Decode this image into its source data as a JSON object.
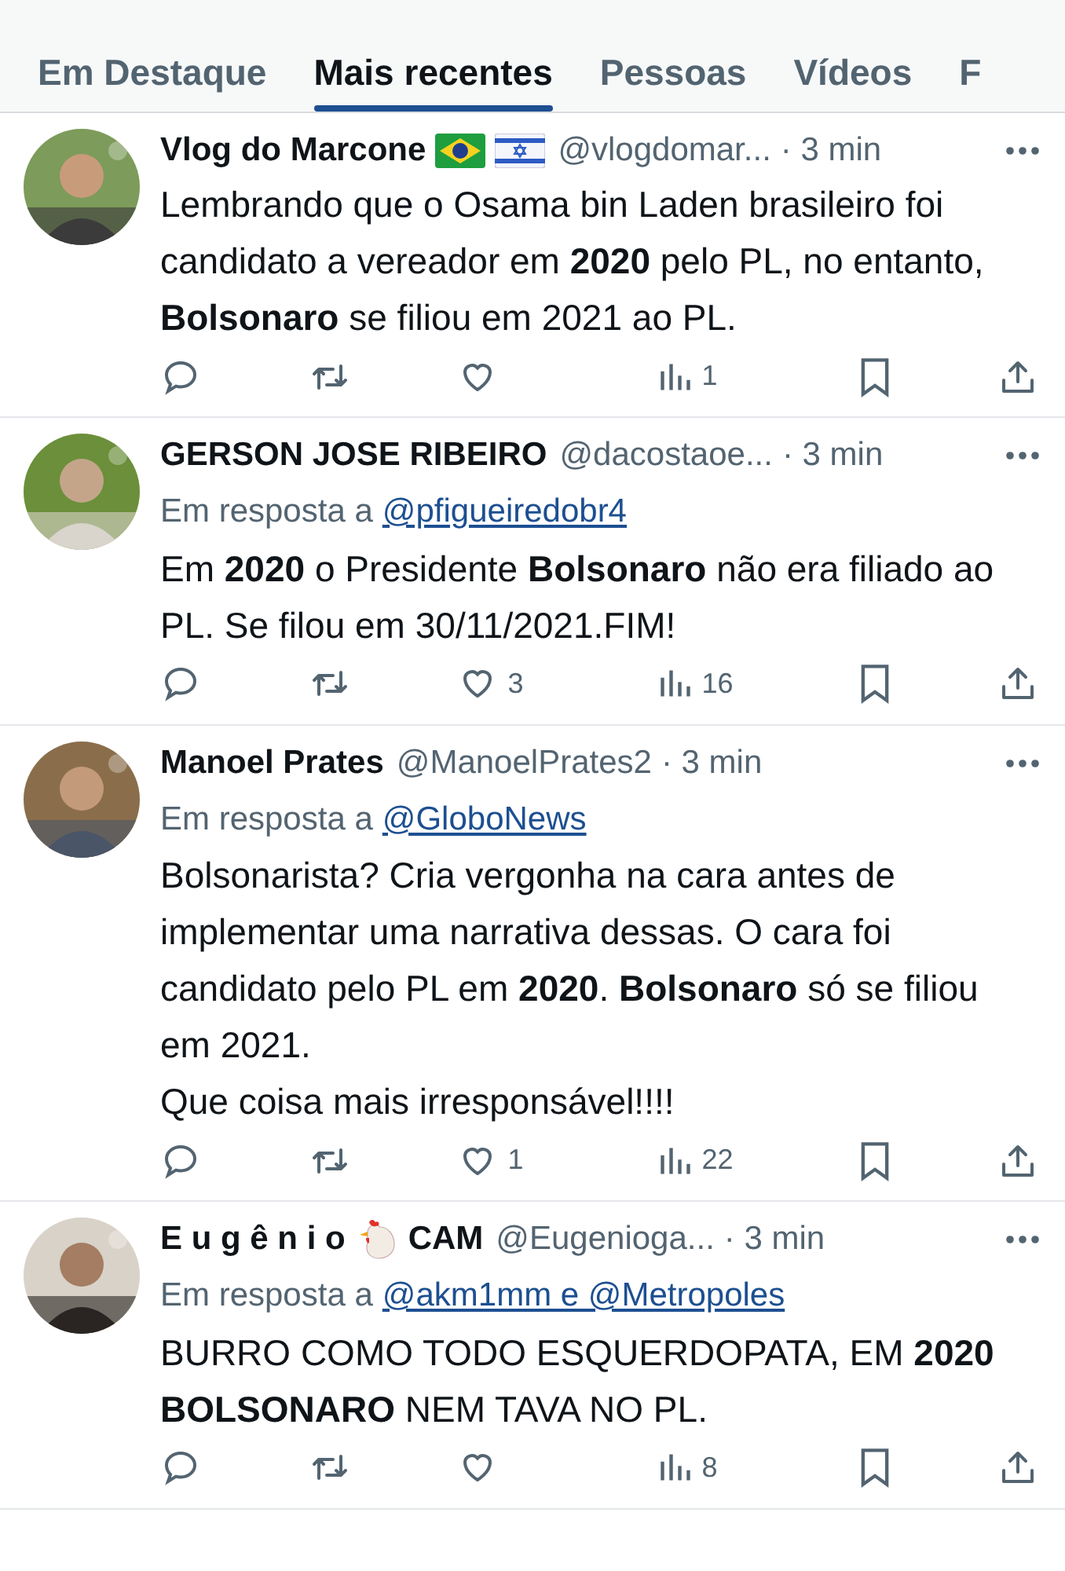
{
  "tabs": [
    {
      "label": "Em Destaque",
      "selected": false
    },
    {
      "label": "Mais recentes",
      "selected": true
    },
    {
      "label": "Pessoas",
      "selected": false
    },
    {
      "label": "Vídeos",
      "selected": false
    },
    {
      "label": "F",
      "selected": false
    }
  ],
  "tweets": [
    {
      "name": "Vlog do Marcone",
      "badges": [
        {
          "kind": "flag-brazil"
        },
        {
          "kind": "flag-israel"
        }
      ],
      "handle": "@vlogdomar...",
      "time": "· 3 min",
      "text": "Lembrando que o Osama bin Laden brasileiro foi candidato a vereador em **2020** pelo PL, no entanto, **Bolsonaro** se filiou em 2021 ao PL.",
      "views": "1"
    },
    {
      "name": "GERSON JOSE RIBEIRO",
      "handle": "@dacostaoe...",
      "time": "· 3 min",
      "reply_prefix": "Em resposta a",
      "reply_to": "@pfigueiredobr4",
      "text": "Em **2020** o Presidente **Bolsonaro** não era filiado ao PL.  Se filou em 30/11/2021.FIM!",
      "likes": "3",
      "views": "16"
    },
    {
      "name": "Manoel Prates",
      "handle": "@ManoelPrates2",
      "time": "· 3 min",
      "reply_prefix": "Em resposta a",
      "reply_to": "@GloboNews",
      "text": "Bolsonarista? Cria vergonha na cara antes de implementar uma narrativa dessas. O cara foi candidato pelo PL em **2020**. **Bolsonaro** só se filiou em 2021.\nQue coisa mais irresponsável!!!!",
      "likes": "1",
      "views": "22"
    },
    {
      "name": "E u g ê n i o",
      "badges": [
        {
          "kind": "chicken"
        },
        {
          "kind": "text",
          "label": "CAM"
        }
      ],
      "handle": "@Eugenioga...",
      "time": "· 3 min",
      "reply_prefix": "Em resposta a",
      "reply_to": "@akm1mm e @Metropoles",
      "text": "BURRO COMO TODO ESQUERDOPATA, EM **2020 BOLSONARO** NEM TAVA NO PL.",
      "views": "8"
    }
  ]
}
